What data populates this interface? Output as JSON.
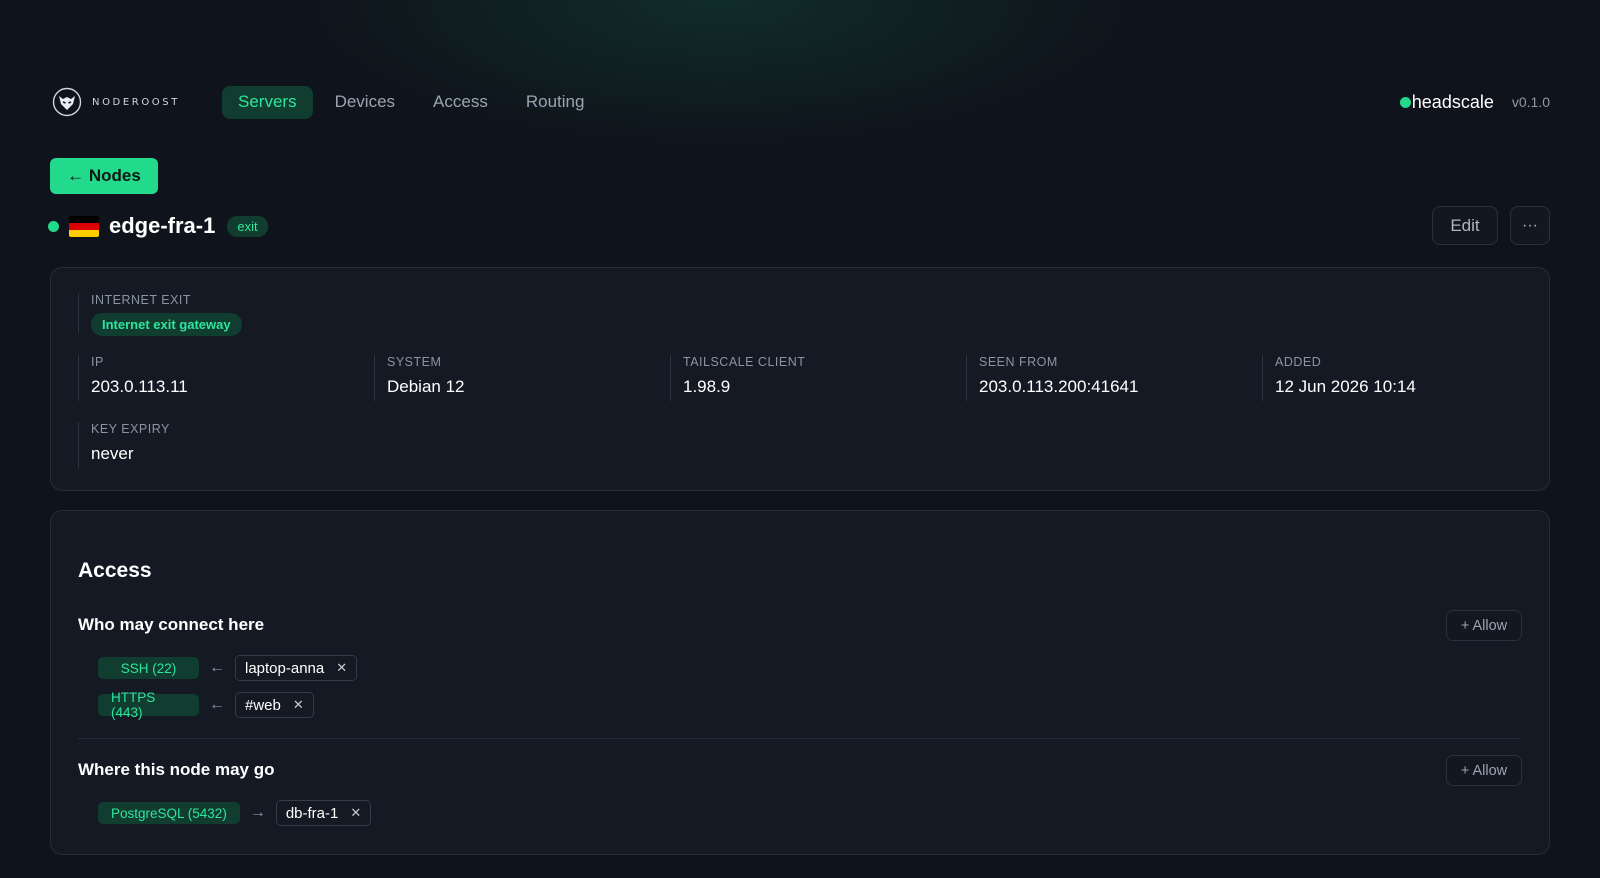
{
  "brand": {
    "logo_text": "NODEROOST",
    "logo_icon": "wolf-shield-icon"
  },
  "nav": {
    "tabs": [
      {
        "label": "Servers",
        "active": true
      },
      {
        "label": "Devices",
        "active": false
      },
      {
        "label": "Access",
        "active": false
      },
      {
        "label": "Routing",
        "active": false
      }
    ]
  },
  "server": {
    "name": "headscale",
    "version": "v0.1.0",
    "status_color": "#22d98c"
  },
  "back_button": {
    "label": "← Nodes"
  },
  "node": {
    "name": "edge-fra-1",
    "tag": "exit",
    "country_flag": "DE",
    "status": "online",
    "edit_label": "Edit",
    "more_label": "···"
  },
  "details": {
    "internet_exit": {
      "label": "INTERNET EXIT",
      "value": "Internet exit gateway"
    },
    "ip": {
      "label": "IP",
      "value": "203.0.113.11"
    },
    "system": {
      "label": "SYSTEM",
      "value": "Debian 12"
    },
    "client": {
      "label": "TAILSCALE CLIENT",
      "value": "1.98.9"
    },
    "seen_from": {
      "label": "SEEN FROM",
      "value": "203.0.113.200:41641"
    },
    "added": {
      "label": "ADDED",
      "value": "12 Jun 2026 10:14"
    },
    "key_expiry": {
      "label": "KEY EXPIRY",
      "value": "never"
    }
  },
  "access": {
    "title": "Access",
    "inbound": {
      "title": "Who may connect here",
      "allow_label": "+ Allow",
      "rules": [
        {
          "port": "SSH (22)",
          "arrow": "←",
          "peer": "laptop-anna"
        },
        {
          "port": "HTTPS (443)",
          "arrow": "←",
          "peer": "#web"
        }
      ]
    },
    "outbound": {
      "title": "Where this node may go",
      "allow_label": "+ Allow",
      "rules": [
        {
          "port": "PostgreSQL (5432)",
          "arrow": "→",
          "peer": "db-fra-1"
        }
      ]
    },
    "remove_glyph": "✕"
  },
  "colors": {
    "accent": "#22d98c",
    "background": "#0f131b",
    "panel": "#141923",
    "tag_bg": "#113d30"
  }
}
